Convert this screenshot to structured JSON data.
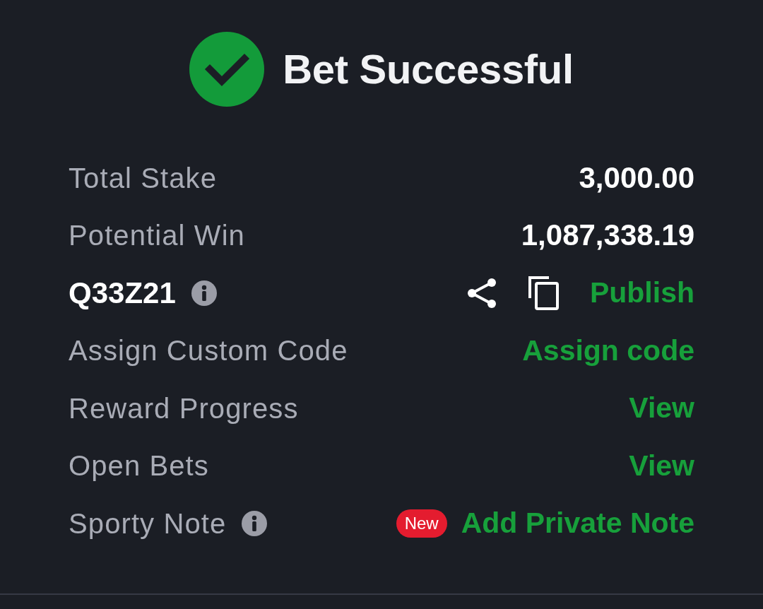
{
  "header": {
    "title": "Bet Successful"
  },
  "rows": [
    {
      "kind": "amount",
      "label": "Total Stake",
      "info": false,
      "value": "3,000.00"
    },
    {
      "kind": "amount",
      "label": "Potential Win",
      "info": false,
      "value": "1,087,338.19"
    },
    {
      "kind": "code",
      "label": "Q33Z21",
      "info": true,
      "action": "Publish"
    },
    {
      "kind": "link",
      "label": "Assign Custom Code",
      "info": false,
      "action": "Assign code"
    },
    {
      "kind": "link",
      "label": "Reward Progress",
      "info": false,
      "action": "View"
    },
    {
      "kind": "link",
      "label": "Open Bets",
      "info": false,
      "action": "View"
    },
    {
      "kind": "note",
      "label": "Sporty Note",
      "info": true,
      "badge": "New",
      "action": "Add Private Note"
    }
  ]
}
